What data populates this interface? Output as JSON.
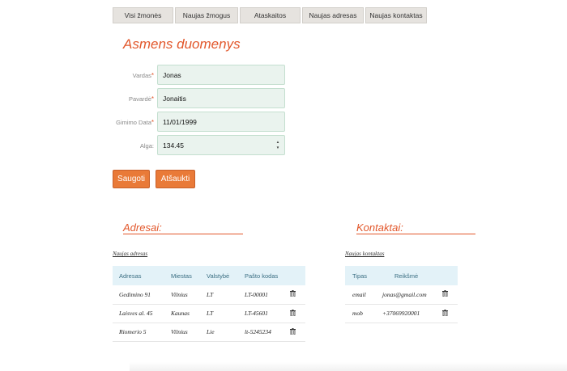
{
  "nav": {
    "tabs": [
      {
        "label": "Visi žmonės"
      },
      {
        "label": "Naujas žmogus"
      },
      {
        "label": "Ataskaitos"
      },
      {
        "label": "Naujas adresas"
      },
      {
        "label": "Naujas kontaktas"
      }
    ]
  },
  "form": {
    "title": "Asmens duomenys",
    "required_mark": "*",
    "fields": [
      {
        "label": "Vardas",
        "required": true,
        "value": "Jonas"
      },
      {
        "label": "Pavardė",
        "required": true,
        "value": "Jonaitis"
      },
      {
        "label": "Gimimo Data",
        "required": true,
        "value": "11/01/1999"
      },
      {
        "label": "Alga:",
        "required": false,
        "value": "134.45"
      }
    ],
    "save_label": "Saugoti",
    "cancel_label": "Atšaukti"
  },
  "addresses": {
    "title": "Adresai:",
    "new_link": "Naujas adresas",
    "columns": [
      "Adresas",
      "Miestas",
      "Valstybė",
      "Pašto kodas"
    ],
    "rows": [
      [
        "Gedimino 91",
        "Vilnius",
        "LT",
        "LT-00001"
      ],
      [
        "Laisves al. 45",
        "Kaunas",
        "LT",
        "LT-45601"
      ],
      [
        "Riomerio 5",
        "Vilnius",
        "Lie",
        "lt-5245234"
      ]
    ]
  },
  "contacts": {
    "title": "Kontaktai:",
    "new_link": "Naujas kontaktas",
    "columns": [
      "Tipas",
      "Reikšmė"
    ],
    "rows": [
      [
        "email",
        "jonas@gmail.com"
      ],
      [
        "mob",
        "+37069920001"
      ]
    ]
  },
  "icons": {
    "delete": "trash-icon",
    "spinner": "number-spinner-icon"
  },
  "colors": {
    "accent": "#e2572b",
    "button": "#e97a38",
    "field_bg": "#eaf3ee",
    "table_header": "#e3f2f8",
    "nav_bg": "#e6e3df"
  }
}
